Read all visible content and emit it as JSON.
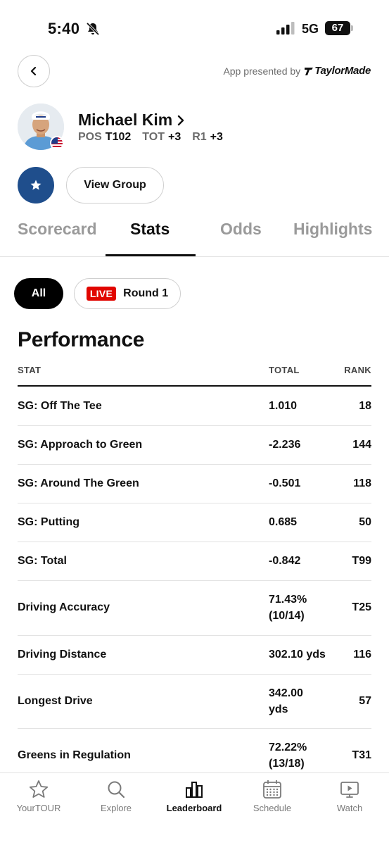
{
  "status_bar": {
    "time": "5:40",
    "network": "5G",
    "battery": "67"
  },
  "header": {
    "sponsor_text": "App presented by",
    "sponsor_logo": "TaylorMade"
  },
  "player": {
    "name": "Michael Kim",
    "pos_label": "POS",
    "pos_value": "T102",
    "tot_label": "TOT",
    "tot_value": "+3",
    "r1_label": "R1",
    "r1_value": "+3",
    "country_flag": "flag-usa-icon"
  },
  "actions": {
    "favorite_icon": "star-icon",
    "view_group_label": "View Group"
  },
  "tabs": [
    {
      "label": "Scorecard",
      "active": false
    },
    {
      "label": "Stats",
      "active": true
    },
    {
      "label": "Odds",
      "active": false
    },
    {
      "label": "Highlights",
      "active": false
    }
  ],
  "filters": {
    "all_label": "All",
    "live_label": "LIVE",
    "round_label": "Round 1"
  },
  "performance": {
    "title": "Performance",
    "headers": {
      "stat": "STAT",
      "total": "TOTAL",
      "rank": "RANK"
    },
    "rows": [
      {
        "stat": "SG: Off The Tee",
        "total_1": "1.010",
        "total_2": "",
        "rank": "18"
      },
      {
        "stat": "SG: Approach to Green",
        "total_1": "-2.236",
        "total_2": "",
        "rank": "144"
      },
      {
        "stat": "SG: Around The Green",
        "total_1": "-0.501",
        "total_2": "",
        "rank": "118"
      },
      {
        "stat": "SG: Putting",
        "total_1": "0.685",
        "total_2": "",
        "rank": "50"
      },
      {
        "stat": "SG: Total",
        "total_1": "-0.842",
        "total_2": "",
        "rank": "T99"
      },
      {
        "stat": "Driving Accuracy",
        "total_1": "71.43%",
        "total_2": "(10/14)",
        "rank": "T25"
      },
      {
        "stat": "Driving Distance",
        "total_1": "302.10 yds",
        "total_2": "",
        "rank": "116"
      },
      {
        "stat": "Longest Drive",
        "total_1": "342.00",
        "total_2": "yds",
        "rank": "57"
      },
      {
        "stat": "Greens in Regulation",
        "total_1": "72.22%",
        "total_2": "(13/18)",
        "rank": "T31"
      }
    ]
  },
  "bottom_nav": [
    {
      "label": "YourTOUR",
      "icon": "star-outline-icon",
      "active": false
    },
    {
      "label": "Explore",
      "icon": "search-icon",
      "active": false
    },
    {
      "label": "Leaderboard",
      "icon": "bar-chart-icon",
      "active": true
    },
    {
      "label": "Schedule",
      "icon": "calendar-icon",
      "active": false
    },
    {
      "label": "Watch",
      "icon": "play-screen-icon",
      "active": false
    }
  ],
  "colors": {
    "accent_blue": "#1f4e8c",
    "live_red": "#e10600",
    "inactive_gray": "#9a9a9a"
  }
}
